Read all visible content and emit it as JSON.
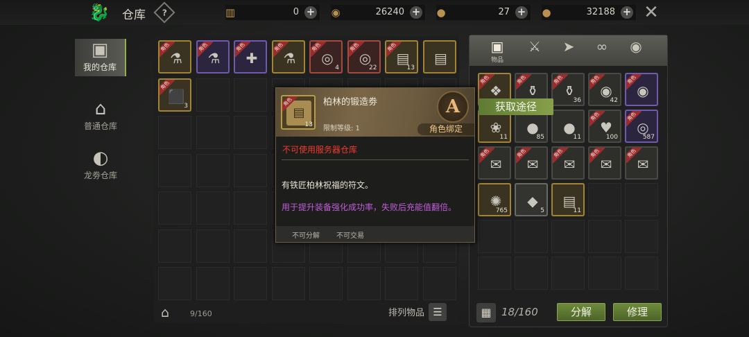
{
  "header": {
    "title": "仓库",
    "help_icon": "question-diamond-icon",
    "currencies": [
      {
        "icon": "scroll-ticket-icon",
        "value": "0"
      },
      {
        "icon": "swirl-coin-icon",
        "value": "26240"
      },
      {
        "icon": "gem-pouch-icon",
        "value": "27"
      },
      {
        "icon": "gold-coin-icon",
        "value": "32188"
      }
    ]
  },
  "nav": [
    {
      "label": "我的仓库",
      "icon": "box-icon",
      "active": true
    },
    {
      "label": "普通仓库",
      "icon": "storehouse-icon",
      "active": false
    },
    {
      "label": "龙劵仓库",
      "icon": "dragon-coin-icon",
      "active": false
    }
  ],
  "storage": {
    "items": [
      {
        "ribbon": "角色",
        "quality": "gold",
        "glyph": "⚗",
        "count": ""
      },
      {
        "ribbon": "角色",
        "quality": "purple",
        "glyph": "⚗",
        "count": ""
      },
      {
        "ribbon": "角色",
        "quality": "purple",
        "glyph": "✚",
        "count": ""
      },
      {
        "ribbon": "角色",
        "quality": "gold",
        "glyph": "⚗",
        "count": ""
      },
      {
        "ribbon": "角色",
        "quality": "red",
        "glyph": "◎",
        "count": "4"
      },
      {
        "ribbon": "角色",
        "quality": "red",
        "glyph": "◎",
        "count": "22"
      },
      {
        "ribbon": "角色",
        "quality": "gold",
        "glyph": "▤",
        "count": "13"
      },
      {
        "ribbon": "",
        "quality": "gold",
        "glyph": "▤",
        "count": ""
      },
      {
        "ribbon": "角色",
        "quality": "gold",
        "glyph": "⬛",
        "count": "3"
      }
    ],
    "count": "9/160",
    "sort_label": "排列物品"
  },
  "bag": {
    "tabs": [
      {
        "icon": "box-icon",
        "label": "物品"
      },
      {
        "icon": "sword-icon",
        "label": ""
      },
      {
        "icon": "arrow-icon",
        "label": ""
      },
      {
        "icon": "link-icon",
        "label": ""
      },
      {
        "icon": "swirl-icon",
        "label": ""
      }
    ],
    "items": [
      {
        "ribbon": "角色",
        "quality": "gold",
        "glyph": "❖",
        "count": ""
      },
      {
        "ribbon": "角色",
        "quality": "plain",
        "glyph": "⚱",
        "count": ""
      },
      {
        "ribbon": "角色",
        "quality": "plain",
        "glyph": "⚱",
        "count": "36"
      },
      {
        "ribbon": "角色",
        "quality": "plain",
        "glyph": "◉",
        "count": "42"
      },
      {
        "ribbon": "角色",
        "quality": "purple",
        "glyph": "◉",
        "count": ""
      },
      {
        "ribbon": "",
        "quality": "gold",
        "glyph": "❀",
        "count": "11"
      },
      {
        "ribbon": "",
        "quality": "plain",
        "glyph": "●",
        "count": "85"
      },
      {
        "ribbon": "",
        "quality": "plain",
        "glyph": "●",
        "count": "11"
      },
      {
        "ribbon": "角色",
        "quality": "plain",
        "glyph": "♥",
        "count": "100"
      },
      {
        "ribbon": "角色",
        "quality": "purple",
        "glyph": "◎",
        "count": "587"
      },
      {
        "ribbon": "角色",
        "quality": "plain",
        "glyph": "✉",
        "count": ""
      },
      {
        "ribbon": "角色",
        "quality": "plain",
        "glyph": "✉",
        "count": ""
      },
      {
        "ribbon": "角色",
        "quality": "plain",
        "glyph": "✉",
        "count": ""
      },
      {
        "ribbon": "角色",
        "quality": "plain",
        "glyph": "✉",
        "count": ""
      },
      {
        "ribbon": "角色",
        "quality": "plain",
        "glyph": "✉",
        "count": ""
      },
      {
        "ribbon": "",
        "quality": "gold",
        "glyph": "✺",
        "count": "765"
      },
      {
        "ribbon": "",
        "quality": "gray",
        "glyph": "◆",
        "count": "5"
      },
      {
        "ribbon": "",
        "quality": "gold",
        "glyph": "▤",
        "count": "11"
      }
    ],
    "count": "18/160",
    "decompose_label": "分解",
    "repair_label": "修理"
  },
  "tooltip": {
    "name": "柏林的锻造劵",
    "ribbon": "角色",
    "count": "13",
    "level": "限制等级: 1",
    "grade": "A",
    "bind": "角色绑定",
    "warning": "不可使用服务器仓库",
    "description": "有铁匠柏林祝福的符文。",
    "usage": "用于提升装备强化成功率，失败后充能值翻倍。",
    "flags": [
      "不可分解",
      "不可交易"
    ],
    "get_route_label": "获取途径"
  },
  "colors": {
    "accent_green": "#86a04b",
    "warning_red": "#f03c2c",
    "usage_purple": "#c05ed8",
    "bind_gold": "#f0c98a"
  }
}
